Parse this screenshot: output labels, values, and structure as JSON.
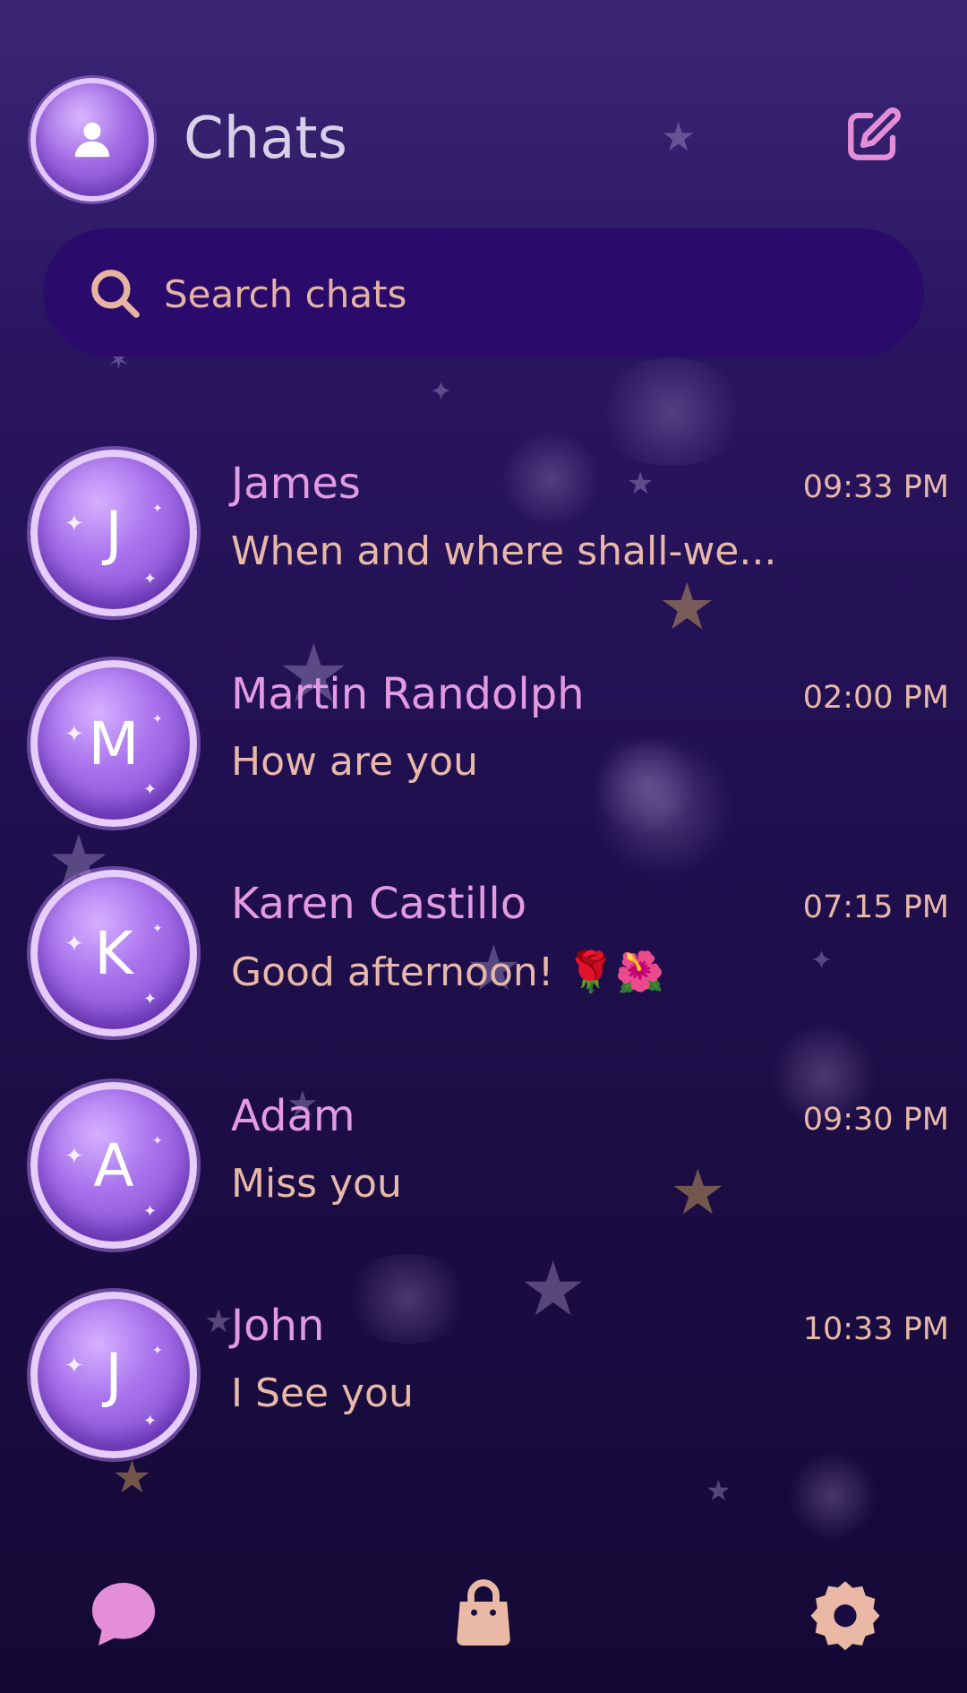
{
  "header": {
    "title": "Chats",
    "profile_icon": "user-icon",
    "compose_icon": "compose-icon"
  },
  "search": {
    "placeholder": "Search chats",
    "value": "",
    "icon": "search-icon"
  },
  "chats": [
    {
      "initial": "J",
      "name": "James",
      "preview": "When and where shall-we...",
      "time": "09:33 PM"
    },
    {
      "initial": "M",
      "name": "Martin Randolph",
      "preview": "How are you",
      "time": "02:00 PM"
    },
    {
      "initial": "K",
      "name": "Karen Castillo",
      "preview": "Good afternoon! 🌹🌺",
      "time": "07:15 PM"
    },
    {
      "initial": "A",
      "name": "Adam",
      "preview": "Miss you",
      "time": "09:30 PM"
    },
    {
      "initial": "J",
      "name": "John",
      "preview": "I See you",
      "time": "10:33 PM"
    }
  ],
  "nav": {
    "items": [
      {
        "icon": "chat-bubble-icon"
      },
      {
        "icon": "shopping-bag-icon"
      },
      {
        "icon": "settings-gear-icon"
      }
    ]
  },
  "colors": {
    "background_top": "#3a2675",
    "background_bottom": "#140935",
    "search_bg": "#2a0a6b",
    "name_color": "#e39ae0",
    "preview_color": "#e8b8a8",
    "title_color": "#d6d0e8",
    "nav_chat": "#e48ed8",
    "nav_peach": "#eab9a6"
  }
}
